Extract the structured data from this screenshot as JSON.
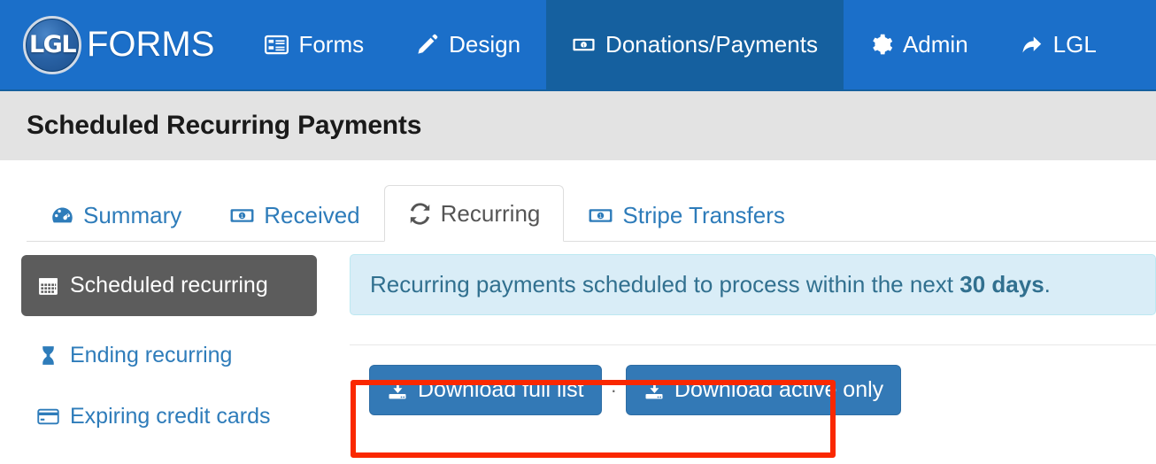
{
  "navbar": {
    "brand": {
      "badge_text": "LGL",
      "word": "FORMS"
    },
    "items": [
      {
        "label": "Forms",
        "icon": "list-alt-icon",
        "active": false
      },
      {
        "label": "Design",
        "icon": "pencil-icon",
        "active": false
      },
      {
        "label": "Donations/Payments",
        "icon": "money-bill-icon",
        "active": true
      },
      {
        "label": "Admin",
        "icon": "gear-icon",
        "active": false
      },
      {
        "label": "LGL",
        "icon": "share-arrow-icon",
        "active": false
      }
    ],
    "background_color": "#1b6fc9",
    "active_color": "#15609f"
  },
  "page": {
    "title": "Scheduled Recurring Payments",
    "titlebar_color": "#e3e3e3"
  },
  "tabs": [
    {
      "label": "Summary",
      "icon": "tachometer-icon",
      "active": false
    },
    {
      "label": "Received",
      "icon": "money-bill-icon",
      "active": false
    },
    {
      "label": "Recurring",
      "icon": "refresh-icon",
      "active": true
    },
    {
      "label": "Stripe Transfers",
      "icon": "money-bill-icon",
      "active": false
    }
  ],
  "sidebar": {
    "items": [
      {
        "label": "Scheduled recurring",
        "icon": "calendar-icon",
        "active": true
      },
      {
        "label": "Ending recurring",
        "icon": "hourglass-icon",
        "active": false
      },
      {
        "label": "Expiring credit cards",
        "icon": "credit-card-icon",
        "active": false
      }
    ],
    "active_color": "#5c5c5c",
    "link_color": "#2e7cba"
  },
  "alert": {
    "text_before": "Recurring payments scheduled to process within the next ",
    "highlight": "30 days",
    "text_after": ".",
    "background_color": "#d9edf7",
    "border_color": "#bce8f1",
    "text_color": "#31708f"
  },
  "actions": {
    "download_full_label": "Download full list",
    "download_active_label": "Download active only",
    "separator": "·",
    "button_color": "#3379b6",
    "download_icon": "download-icon"
  },
  "annotation": {
    "highlight_color": "#fa2800"
  }
}
